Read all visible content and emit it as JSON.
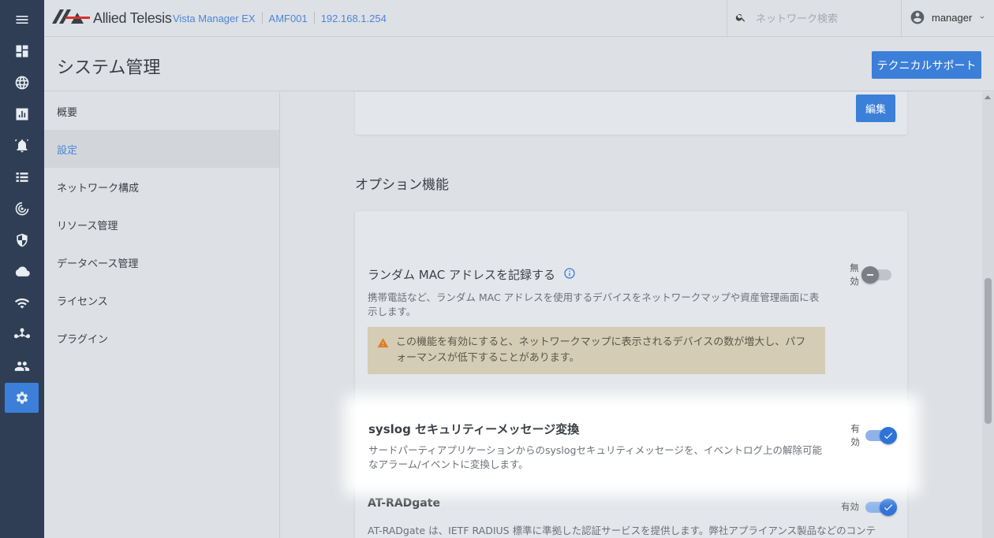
{
  "brand": {
    "name": "Allied Telesis"
  },
  "breadcrumbs": [
    "Vista Manager EX",
    "AMF001",
    "192.168.1.254"
  ],
  "search": {
    "placeholder": "ネットワーク検索"
  },
  "user": {
    "name": "manager"
  },
  "page": {
    "title": "システム管理",
    "tech_support_label": "テクニカルサポート"
  },
  "rail": {
    "icons": [
      "menu-icon",
      "dashboard-icon",
      "globe-icon",
      "chart-icon",
      "alarm-icon",
      "list-icon",
      "radar-icon",
      "shield-icon",
      "cloud-icon",
      "wifi-icon",
      "topology-icon",
      "users-icon",
      "gear-icon"
    ],
    "active": "gear-icon"
  },
  "subnav": {
    "items": [
      "概要",
      "設定",
      "ネットワーク構成",
      "リソース管理",
      "データベース管理",
      "ライセンス",
      "プラグイン"
    ],
    "active": "設定"
  },
  "content": {
    "edit_label": "編集",
    "section_title": "オプション機能",
    "options": [
      {
        "title": "ランダム MAC アドレスを記録する",
        "description": "携帯電話など、ランダム MAC アドレスを使用するデバイスをネットワークマップや資産管理画面に表示します。",
        "warning": "この機能を有効にすると、ネットワークマップに表示されるデバイスの数が増大し、パフォーマンスが低下することがあります。",
        "state_label": "無効",
        "enabled": false
      },
      {
        "title": "syslog セキュリティーメッセージ変換",
        "description": "サードパーティアプリケーションからのsyslogセキュリティメッセージを、イベントログ上の解除可能なアラーム/イベントに変換します。",
        "state_label": "有効",
        "enabled": true
      },
      {
        "title": "AT-RADgate",
        "description": "AT-RADgate は、IETF RADIUS 標準に準拠した認証サービスを提供します。弊社アプライアンス製品などのコンテ",
        "state_label": "有効",
        "enabled": true
      }
    ]
  },
  "colors": {
    "accent": "#3b7fd9",
    "rail": "#2f3e55",
    "warning_bg": "#d4ccb4",
    "warning_icon": "#e07b27"
  }
}
